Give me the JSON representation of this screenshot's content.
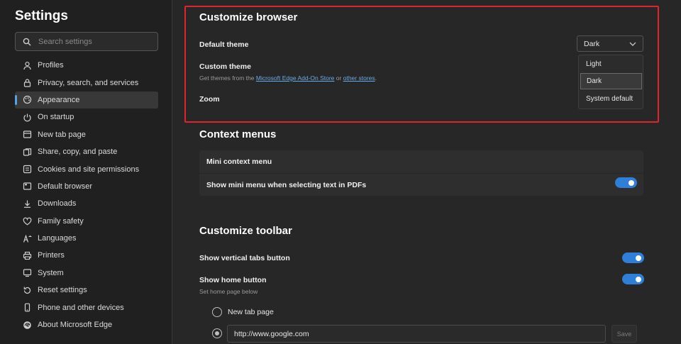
{
  "sidebar": {
    "title": "Settings",
    "search_placeholder": "Search settings",
    "items": [
      {
        "label": "Profiles",
        "icon": "profile-icon"
      },
      {
        "label": "Privacy, search, and services",
        "icon": "lock-icon"
      },
      {
        "label": "Appearance",
        "icon": "appearance-icon",
        "active": true
      },
      {
        "label": "On startup",
        "icon": "power-icon"
      },
      {
        "label": "New tab page",
        "icon": "new-tab-icon"
      },
      {
        "label": "Share, copy, and paste",
        "icon": "share-icon"
      },
      {
        "label": "Cookies and site permissions",
        "icon": "cookies-icon"
      },
      {
        "label": "Default browser",
        "icon": "browser-icon"
      },
      {
        "label": "Downloads",
        "icon": "download-icon"
      },
      {
        "label": "Family safety",
        "icon": "family-icon"
      },
      {
        "label": "Languages",
        "icon": "languages-icon"
      },
      {
        "label": "Printers",
        "icon": "printer-icon"
      },
      {
        "label": "System",
        "icon": "system-icon"
      },
      {
        "label": "Reset settings",
        "icon": "reset-icon"
      },
      {
        "label": "Phone and other devices",
        "icon": "phone-icon"
      },
      {
        "label": "About Microsoft Edge",
        "icon": "edge-icon"
      }
    ]
  },
  "customize_browser": {
    "title": "Customize browser",
    "default_theme_label": "Default theme",
    "default_theme_value": "Dark",
    "theme_options": [
      "Light",
      "Dark",
      "System default"
    ],
    "selected_theme": "Dark",
    "custom_theme_label": "Custom theme",
    "custom_theme_desc_prefix": "Get themes from the",
    "custom_theme_link1": "Microsoft Edge Add-On Store",
    "custom_theme_desc_mid": "or",
    "custom_theme_link2": "other stores",
    "custom_theme_desc_suffix": ".",
    "zoom_label": "Zoom"
  },
  "context_menus": {
    "title": "Context menus",
    "card_title": "Mini context menu",
    "pdf_toggle_label": "Show mini menu when selecting text in PDFs",
    "pdf_toggle_on": true
  },
  "customize_toolbar": {
    "title": "Customize toolbar",
    "vertical_tabs_label": "Show vertical tabs button",
    "vertical_tabs_on": true,
    "home_button_label": "Show home button",
    "home_button_on": true,
    "home_button_sub": "Set home page below",
    "radio_new_tab_label": "New tab page",
    "home_url_value": "http://www.google.com",
    "save_label": "Save"
  },
  "colors": {
    "accent": "#2f7fd8",
    "highlight_border": "#e0232e",
    "background": "#272727",
    "sidebar_background": "#202020"
  }
}
